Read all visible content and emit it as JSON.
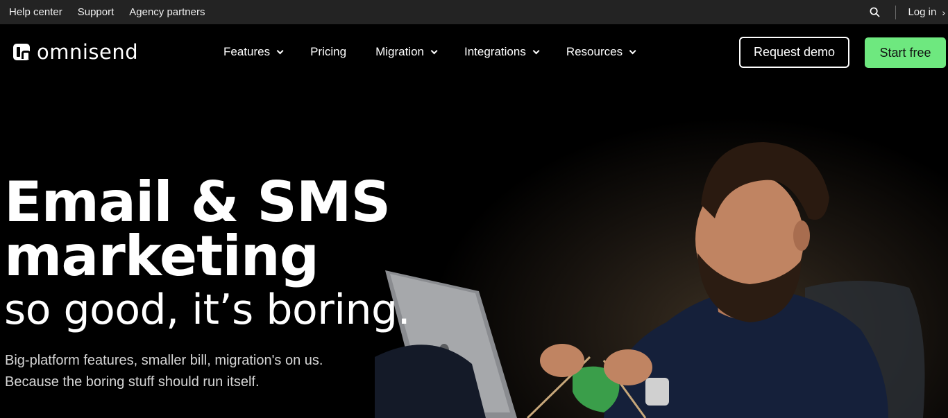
{
  "utility_bar": {
    "links": [
      "Help center",
      "Support",
      "Agency partners"
    ],
    "search_icon": "search-icon",
    "login_label": "Log in",
    "login_chevron": "›"
  },
  "nav": {
    "logo_text": "omnisend",
    "items": [
      {
        "label": "Features",
        "has_dropdown": true
      },
      {
        "label": "Pricing",
        "has_dropdown": false
      },
      {
        "label": "Migration",
        "has_dropdown": true
      },
      {
        "label": "Integrations",
        "has_dropdown": true
      },
      {
        "label": "Resources",
        "has_dropdown": true
      }
    ],
    "request_demo_label": "Request demo",
    "start_free_label": "Start free"
  },
  "hero": {
    "headline_line1": "Email & SMS",
    "headline_line2": "marketing",
    "headline_line3": "so good, it’s boring.",
    "subtext_line1": "Big-platform features, smaller bill, migration's on us.",
    "subtext_line2": "Because the boring stuff should run itself."
  },
  "colors": {
    "utility_bg": "#232323",
    "page_bg": "#000000",
    "accent_green": "#6ee87f"
  }
}
